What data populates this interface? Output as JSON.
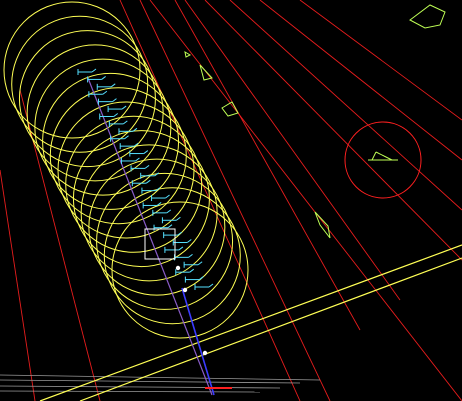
{
  "viewport": {
    "title": "",
    "background": "#000000"
  },
  "colors": {
    "yellow": "#ffff55",
    "yellow_dim": "#e8e86a",
    "red": "#ff2020",
    "cyan": "#55e0ff",
    "green": "#bfff55",
    "blue": "#3b3bff",
    "white": "#ffffff",
    "gray": "#9a9a9a",
    "purple": "#8a5cc8"
  },
  "legend": {
    "glyph_name": "boat-target-icon"
  }
}
